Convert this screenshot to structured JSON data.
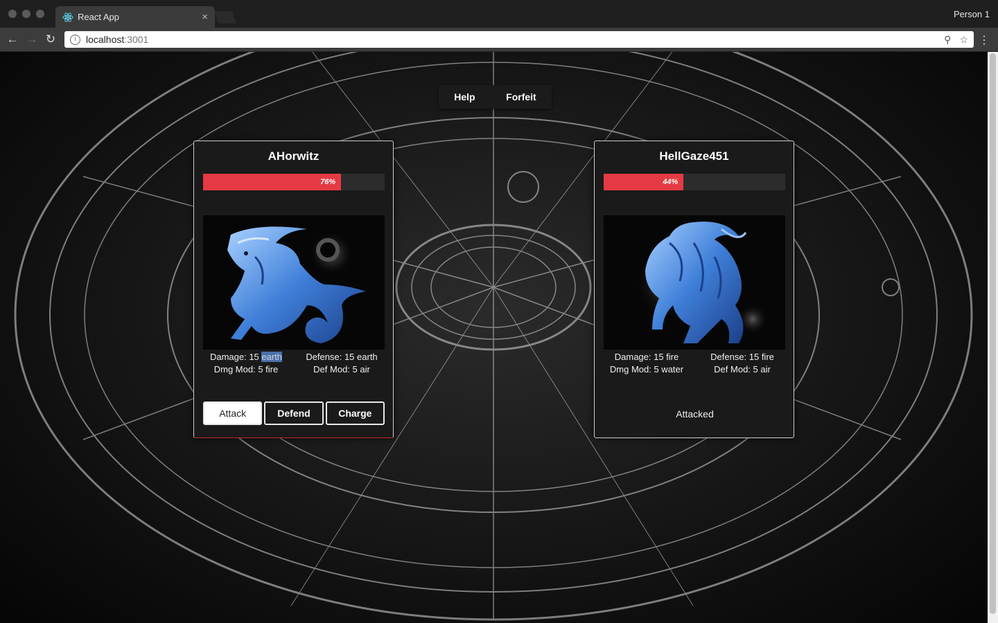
{
  "browser": {
    "tab_title": "React App",
    "tab_close": "×",
    "profile": "Person 1",
    "url_host": "localhost",
    "url_port": ":3001"
  },
  "topbar": {
    "help_label": "Help",
    "forfeit_label": "Forfeit"
  },
  "player": {
    "name": "AHorwitz",
    "hp_percent": 76,
    "hp_label": "76%",
    "damage_prefix": "Damage: 15 ",
    "damage_element": "earth",
    "defense": "Defense: 15 earth",
    "dmg_mod": "Dmg Mod: 5 fire",
    "def_mod": "Def Mod: 5 air",
    "sign": "capricorn",
    "actions": [
      {
        "label": "Attack",
        "active": true
      },
      {
        "label": "Defend",
        "active": false
      },
      {
        "label": "Charge",
        "active": false
      }
    ]
  },
  "opponent": {
    "name": "HellGaze451",
    "hp_percent": 44,
    "hp_label": "44%",
    "damage": "Damage: 15 fire",
    "defense": "Defense: 15 fire",
    "dmg_mod": "Dmg Mod: 5 water",
    "def_mod": "Def Mod: 5 air",
    "sign": "leo",
    "status": "Attacked"
  },
  "colors": {
    "hp_bar": "#e53a43",
    "sign_blue": "#4f8de0"
  }
}
